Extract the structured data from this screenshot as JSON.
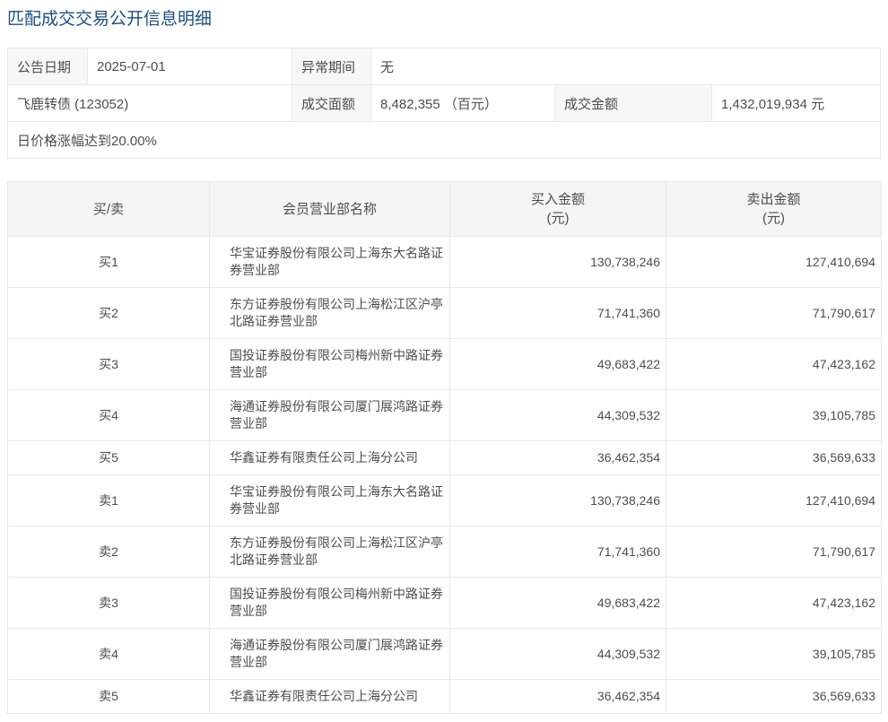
{
  "page_title": "匹配成交交易公开信息明细",
  "colors": {
    "title_accent": "#1f4e79",
    "header_bg": "#f5f5f5",
    "label_bg": "#f7f7f7",
    "border": "#e9e9e9",
    "text": "#4d4d4d"
  },
  "info": {
    "announce_date_label": "公告日期",
    "announce_date": "2025-07-01",
    "abnormal_period_label": "异常期间",
    "abnormal_period": "无",
    "security_name": "飞鹿转债 (123052)",
    "face_amount_label": "成交面额",
    "face_amount": "8,482,355 （百元）",
    "turnover_label": "成交金额",
    "turnover": "1,432,019,934 元",
    "trigger_note": "日价格涨幅达到20.00%"
  },
  "table": {
    "headers": {
      "side": "买/卖",
      "broker": "会员营业部名称",
      "buy": "买入金额",
      "sell": "卖出金额",
      "unit": "(元)"
    },
    "rows": [
      {
        "side": "买1",
        "broker": "华宝证券股份有限公司上海东大名路证券营业部",
        "buy": "130,738,246",
        "sell": "127,410,694"
      },
      {
        "side": "买2",
        "broker": "东方证券股份有限公司上海松江区沪亭北路证券营业部",
        "buy": "71,741,360",
        "sell": "71,790,617"
      },
      {
        "side": "买3",
        "broker": "国投证券股份有限公司梅州新中路证券营业部",
        "buy": "49,683,422",
        "sell": "47,423,162"
      },
      {
        "side": "买4",
        "broker": "海通证券股份有限公司厦门展鸿路证券营业部",
        "buy": "44,309,532",
        "sell": "39,105,785"
      },
      {
        "side": "买5",
        "broker": "华鑫证券有限责任公司上海分公司",
        "buy": "36,462,354",
        "sell": "36,569,633"
      },
      {
        "side": "卖1",
        "broker": "华宝证券股份有限公司上海东大名路证券营业部",
        "buy": "130,738,246",
        "sell": "127,410,694"
      },
      {
        "side": "卖2",
        "broker": "东方证券股份有限公司上海松江区沪亭北路证券营业部",
        "buy": "71,741,360",
        "sell": "71,790,617"
      },
      {
        "side": "卖3",
        "broker": "国投证券股份有限公司梅州新中路证券营业部",
        "buy": "49,683,422",
        "sell": "47,423,162"
      },
      {
        "side": "卖4",
        "broker": "海通证券股份有限公司厦门展鸿路证券营业部",
        "buy": "44,309,532",
        "sell": "39,105,785"
      },
      {
        "side": "卖5",
        "broker": "华鑫证券有限责任公司上海分公司",
        "buy": "36,462,354",
        "sell": "36,569,633"
      }
    ]
  }
}
